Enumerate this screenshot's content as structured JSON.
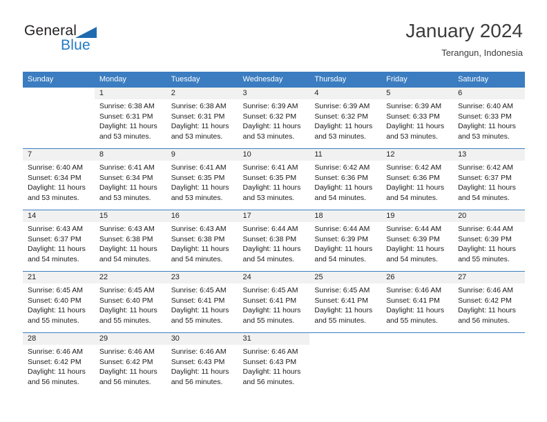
{
  "brand": {
    "word_one": "General",
    "word_two": "Blue",
    "triangle_color": "#1f6bb0",
    "blue_color": "#1f7ac4"
  },
  "header": {
    "title": "January 2024",
    "subtitle": "Terangun, Indonesia"
  },
  "theme": {
    "header_bg": "#3b7dc0",
    "header_text": "#ffffff",
    "daynum_band": "#f1f1f1",
    "row_border": "#3b7dc0"
  },
  "weekday_headers": [
    "Sunday",
    "Monday",
    "Tuesday",
    "Wednesday",
    "Thursday",
    "Friday",
    "Saturday"
  ],
  "weeks": [
    [
      {
        "day": "",
        "sunrise": "",
        "sunset": "",
        "daylight_1": "",
        "daylight_2": ""
      },
      {
        "day": "1",
        "sunrise": "Sunrise: 6:38 AM",
        "sunset": "Sunset: 6:31 PM",
        "daylight_1": "Daylight: 11 hours",
        "daylight_2": "and 53 minutes."
      },
      {
        "day": "2",
        "sunrise": "Sunrise: 6:38 AM",
        "sunset": "Sunset: 6:31 PM",
        "daylight_1": "Daylight: 11 hours",
        "daylight_2": "and 53 minutes."
      },
      {
        "day": "3",
        "sunrise": "Sunrise: 6:39 AM",
        "sunset": "Sunset: 6:32 PM",
        "daylight_1": "Daylight: 11 hours",
        "daylight_2": "and 53 minutes."
      },
      {
        "day": "4",
        "sunrise": "Sunrise: 6:39 AM",
        "sunset": "Sunset: 6:32 PM",
        "daylight_1": "Daylight: 11 hours",
        "daylight_2": "and 53 minutes."
      },
      {
        "day": "5",
        "sunrise": "Sunrise: 6:39 AM",
        "sunset": "Sunset: 6:33 PM",
        "daylight_1": "Daylight: 11 hours",
        "daylight_2": "and 53 minutes."
      },
      {
        "day": "6",
        "sunrise": "Sunrise: 6:40 AM",
        "sunset": "Sunset: 6:33 PM",
        "daylight_1": "Daylight: 11 hours",
        "daylight_2": "and 53 minutes."
      }
    ],
    [
      {
        "day": "7",
        "sunrise": "Sunrise: 6:40 AM",
        "sunset": "Sunset: 6:34 PM",
        "daylight_1": "Daylight: 11 hours",
        "daylight_2": "and 53 minutes."
      },
      {
        "day": "8",
        "sunrise": "Sunrise: 6:41 AM",
        "sunset": "Sunset: 6:34 PM",
        "daylight_1": "Daylight: 11 hours",
        "daylight_2": "and 53 minutes."
      },
      {
        "day": "9",
        "sunrise": "Sunrise: 6:41 AM",
        "sunset": "Sunset: 6:35 PM",
        "daylight_1": "Daylight: 11 hours",
        "daylight_2": "and 53 minutes."
      },
      {
        "day": "10",
        "sunrise": "Sunrise: 6:41 AM",
        "sunset": "Sunset: 6:35 PM",
        "daylight_1": "Daylight: 11 hours",
        "daylight_2": "and 53 minutes."
      },
      {
        "day": "11",
        "sunrise": "Sunrise: 6:42 AM",
        "sunset": "Sunset: 6:36 PM",
        "daylight_1": "Daylight: 11 hours",
        "daylight_2": "and 54 minutes."
      },
      {
        "day": "12",
        "sunrise": "Sunrise: 6:42 AM",
        "sunset": "Sunset: 6:36 PM",
        "daylight_1": "Daylight: 11 hours",
        "daylight_2": "and 54 minutes."
      },
      {
        "day": "13",
        "sunrise": "Sunrise: 6:42 AM",
        "sunset": "Sunset: 6:37 PM",
        "daylight_1": "Daylight: 11 hours",
        "daylight_2": "and 54 minutes."
      }
    ],
    [
      {
        "day": "14",
        "sunrise": "Sunrise: 6:43 AM",
        "sunset": "Sunset: 6:37 PM",
        "daylight_1": "Daylight: 11 hours",
        "daylight_2": "and 54 minutes."
      },
      {
        "day": "15",
        "sunrise": "Sunrise: 6:43 AM",
        "sunset": "Sunset: 6:38 PM",
        "daylight_1": "Daylight: 11 hours",
        "daylight_2": "and 54 minutes."
      },
      {
        "day": "16",
        "sunrise": "Sunrise: 6:43 AM",
        "sunset": "Sunset: 6:38 PM",
        "daylight_1": "Daylight: 11 hours",
        "daylight_2": "and 54 minutes."
      },
      {
        "day": "17",
        "sunrise": "Sunrise: 6:44 AM",
        "sunset": "Sunset: 6:38 PM",
        "daylight_1": "Daylight: 11 hours",
        "daylight_2": "and 54 minutes."
      },
      {
        "day": "18",
        "sunrise": "Sunrise: 6:44 AM",
        "sunset": "Sunset: 6:39 PM",
        "daylight_1": "Daylight: 11 hours",
        "daylight_2": "and 54 minutes."
      },
      {
        "day": "19",
        "sunrise": "Sunrise: 6:44 AM",
        "sunset": "Sunset: 6:39 PM",
        "daylight_1": "Daylight: 11 hours",
        "daylight_2": "and 54 minutes."
      },
      {
        "day": "20",
        "sunrise": "Sunrise: 6:44 AM",
        "sunset": "Sunset: 6:39 PM",
        "daylight_1": "Daylight: 11 hours",
        "daylight_2": "and 55 minutes."
      }
    ],
    [
      {
        "day": "21",
        "sunrise": "Sunrise: 6:45 AM",
        "sunset": "Sunset: 6:40 PM",
        "daylight_1": "Daylight: 11 hours",
        "daylight_2": "and 55 minutes."
      },
      {
        "day": "22",
        "sunrise": "Sunrise: 6:45 AM",
        "sunset": "Sunset: 6:40 PM",
        "daylight_1": "Daylight: 11 hours",
        "daylight_2": "and 55 minutes."
      },
      {
        "day": "23",
        "sunrise": "Sunrise: 6:45 AM",
        "sunset": "Sunset: 6:41 PM",
        "daylight_1": "Daylight: 11 hours",
        "daylight_2": "and 55 minutes."
      },
      {
        "day": "24",
        "sunrise": "Sunrise: 6:45 AM",
        "sunset": "Sunset: 6:41 PM",
        "daylight_1": "Daylight: 11 hours",
        "daylight_2": "and 55 minutes."
      },
      {
        "day": "25",
        "sunrise": "Sunrise: 6:45 AM",
        "sunset": "Sunset: 6:41 PM",
        "daylight_1": "Daylight: 11 hours",
        "daylight_2": "and 55 minutes."
      },
      {
        "day": "26",
        "sunrise": "Sunrise: 6:46 AM",
        "sunset": "Sunset: 6:41 PM",
        "daylight_1": "Daylight: 11 hours",
        "daylight_2": "and 55 minutes."
      },
      {
        "day": "27",
        "sunrise": "Sunrise: 6:46 AM",
        "sunset": "Sunset: 6:42 PM",
        "daylight_1": "Daylight: 11 hours",
        "daylight_2": "and 56 minutes."
      }
    ],
    [
      {
        "day": "28",
        "sunrise": "Sunrise: 6:46 AM",
        "sunset": "Sunset: 6:42 PM",
        "daylight_1": "Daylight: 11 hours",
        "daylight_2": "and 56 minutes."
      },
      {
        "day": "29",
        "sunrise": "Sunrise: 6:46 AM",
        "sunset": "Sunset: 6:42 PM",
        "daylight_1": "Daylight: 11 hours",
        "daylight_2": "and 56 minutes."
      },
      {
        "day": "30",
        "sunrise": "Sunrise: 6:46 AM",
        "sunset": "Sunset: 6:43 PM",
        "daylight_1": "Daylight: 11 hours",
        "daylight_2": "and 56 minutes."
      },
      {
        "day": "31",
        "sunrise": "Sunrise: 6:46 AM",
        "sunset": "Sunset: 6:43 PM",
        "daylight_1": "Daylight: 11 hours",
        "daylight_2": "and 56 minutes."
      },
      {
        "day": "",
        "sunrise": "",
        "sunset": "",
        "daylight_1": "",
        "daylight_2": ""
      },
      {
        "day": "",
        "sunrise": "",
        "sunset": "",
        "daylight_1": "",
        "daylight_2": ""
      },
      {
        "day": "",
        "sunrise": "",
        "sunset": "",
        "daylight_1": "",
        "daylight_2": ""
      }
    ]
  ]
}
